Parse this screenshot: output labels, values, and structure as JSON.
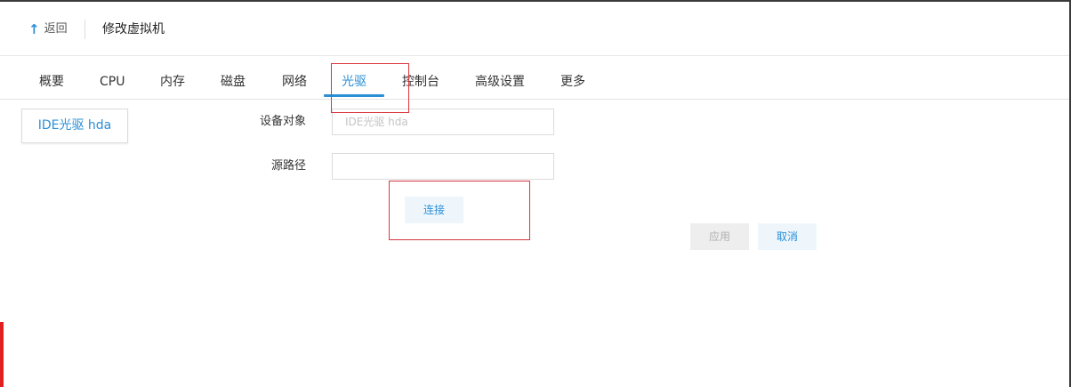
{
  "header": {
    "back_label": "返回",
    "back_icon": "↑",
    "title": "修改虚拟机"
  },
  "tabs": [
    {
      "label": "概要",
      "active": false
    },
    {
      "label": "CPU",
      "active": false
    },
    {
      "label": "内存",
      "active": false
    },
    {
      "label": "磁盘",
      "active": false
    },
    {
      "label": "网络",
      "active": false
    },
    {
      "label": "光驱",
      "active": true
    },
    {
      "label": "控制台",
      "active": false
    },
    {
      "label": "高级设置",
      "active": false
    },
    {
      "label": "更多",
      "active": false
    }
  ],
  "device_list": {
    "selected": "IDE光驱 hda"
  },
  "form": {
    "device_label": "设备对象",
    "device_placeholder": "IDE光驱 hda",
    "device_value": "",
    "source_label": "源路径",
    "source_placeholder": "",
    "source_value": ""
  },
  "buttons": {
    "connect": "连接",
    "apply": "应用",
    "cancel": "取消"
  },
  "colors": {
    "accent": "#2b8fd6",
    "highlight": "#d9363e",
    "disabled_bg": "#eeeeee"
  }
}
